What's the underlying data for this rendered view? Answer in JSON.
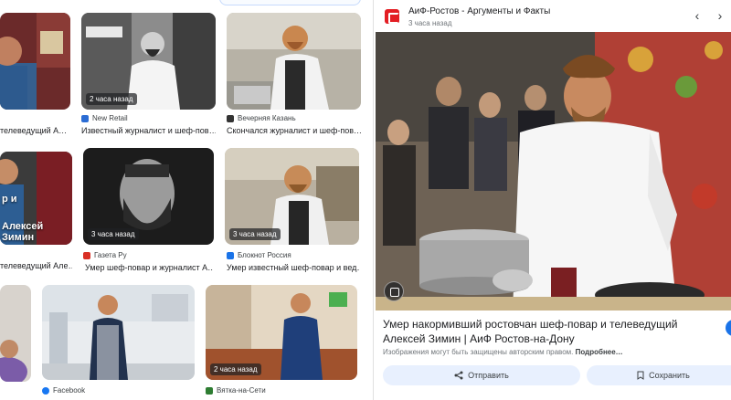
{
  "grid": {
    "tiles": [
      {
        "caption": "те­леведущий А…",
        "source": "",
        "time": ""
      },
      {
        "caption": "Известный журналист и шеф-пов…",
        "source": "New Retail",
        "time": "2 часа назад"
      },
      {
        "caption": "Скончался журналист и шеф-пов…",
        "source": "Вечерняя Казань",
        "time": ""
      },
      {
        "caption": "телеведущий Але…",
        "source": "",
        "time": "",
        "overlay": "Алексей Зимин"
      },
      {
        "caption": "Умер шеф-повар и журналист А…",
        "source": "Газета Ру",
        "time": "3 часа назад"
      },
      {
        "caption": "Умер известный шеф-повар и вед…",
        "source": "Блокнот Россия",
        "time": "3 часа назад"
      },
      {
        "caption": "",
        "source": "",
        "time": ""
      },
      {
        "caption": "",
        "source": "Facebook",
        "time": ""
      },
      {
        "caption": "",
        "source": "Вятка-на-Сети",
        "time": "2 часа назад"
      }
    ]
  },
  "panel": {
    "site_name": "АиФ-Ростов - Аргументы и Факты",
    "time": "3 часа назад",
    "title": "Умер накормивший ростовчан шеф-повар и телеведущий Алексей Зимин | АиФ Ростов-на-Дону",
    "copyright_text": "Изображения могут быть защищены авторским правом.",
    "copyright_more": "Подробнее…",
    "share_label": "Отправить",
    "save_label": "Сохранить",
    "prev_icon": "chevron-left-icon",
    "next_icon": "chevron-right-icon"
  }
}
